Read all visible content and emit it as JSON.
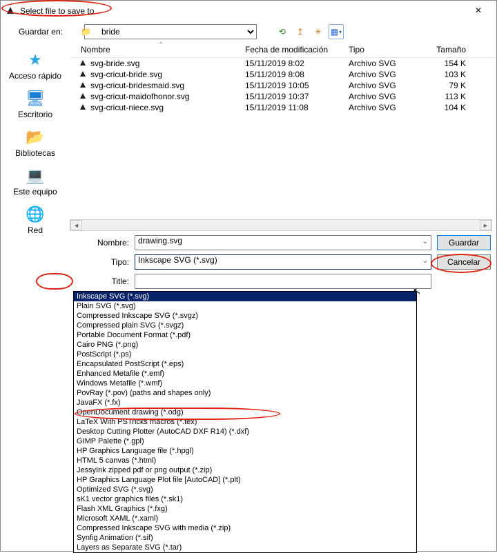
{
  "title": "Select file to save to",
  "close": "×",
  "lookin_label": "Guardar en:",
  "lookin_value": "bride",
  "places": [
    {
      "label": "Acceso rápido",
      "glyph": "★",
      "color": "#2aa7e0"
    },
    {
      "label": "Escritorio",
      "glyph": "🖥",
      "color": "#1e7fd6"
    },
    {
      "label": "Bibliotecas",
      "glyph": "📂",
      "color": "#f2b200"
    },
    {
      "label": "Este equipo",
      "glyph": "💻",
      "color": "#1e7fd6"
    },
    {
      "label": "Red",
      "glyph": "🌐",
      "color": "#1e7fd6"
    }
  ],
  "cols": {
    "name": "Nombre",
    "date": "Fecha de modificación",
    "type": "Tipo",
    "size": "Tamaño",
    "sort": "^"
  },
  "files": [
    {
      "name": "svg-bride.svg",
      "date": "15/11/2019 8:02",
      "type": "Archivo SVG",
      "size": "154 K"
    },
    {
      "name": "svg-cricut-bride.svg",
      "date": "15/11/2019 8:08",
      "type": "Archivo SVG",
      "size": "103 K"
    },
    {
      "name": "svg-cricut-bridesmaid.svg",
      "date": "15/11/2019 10:05",
      "type": "Archivo SVG",
      "size": "79 K"
    },
    {
      "name": "svg-cricut-maidofhonor.svg",
      "date": "15/11/2019 10:37",
      "type": "Archivo SVG",
      "size": "113 K"
    },
    {
      "name": "svg-cricut-niece.svg",
      "date": "15/11/2019 11:08",
      "type": "Archivo SVG",
      "size": "104 K"
    }
  ],
  "labels": {
    "nombre": "Nombre:",
    "tipo": "Tipo:",
    "title": "Title:"
  },
  "filename": "drawing.svg",
  "filetype": "Inkscape SVG (*.svg)",
  "title_value": "",
  "btn_save": "Guardar",
  "btn_cancel": "Cancelar",
  "navglyphs": {
    "back": "⟲",
    "up": "↥",
    "new": "✳",
    "view": "▦",
    "viewchev": "▾"
  },
  "dropdown": [
    "Inkscape SVG (*.svg)",
    "Plain SVG (*.svg)",
    "Compressed Inkscape SVG (*.svgz)",
    "Compressed plain SVG (*.svgz)",
    "Portable Document Format (*.pdf)",
    "Cairo PNG (*.png)",
    "PostScript (*.ps)",
    "Encapsulated PostScript (*.eps)",
    "Enhanced Metafile (*.emf)",
    "Windows Metafile (*.wmf)",
    "PovRay (*.pov) (paths and shapes only)",
    "JavaFX (*.fx)",
    "OpenDocument drawing (*.odg)",
    "LaTeX With PSTricks macros (*.tex)",
    "Desktop Cutting Plotter (AutoCAD DXF R14) (*.dxf)",
    "GIMP Palette (*.gpl)",
    "HP Graphics Language file (*.hpgl)",
    "HTML 5 canvas (*.html)",
    "JessyInk zipped pdf or png output (*.zip)",
    "HP Graphics Language Plot file [AutoCAD] (*.plt)",
    "Optimized SVG (*.svg)",
    "sK1 vector graphics files (*.sk1)",
    "Flash XML Graphics (*.fxg)",
    "Microsoft XAML (*.xaml)",
    "Compressed Inkscape SVG with media (*.zip)",
    "Synfig Animation (*.sif)",
    "Layers as Separate SVG (*.tar)"
  ]
}
